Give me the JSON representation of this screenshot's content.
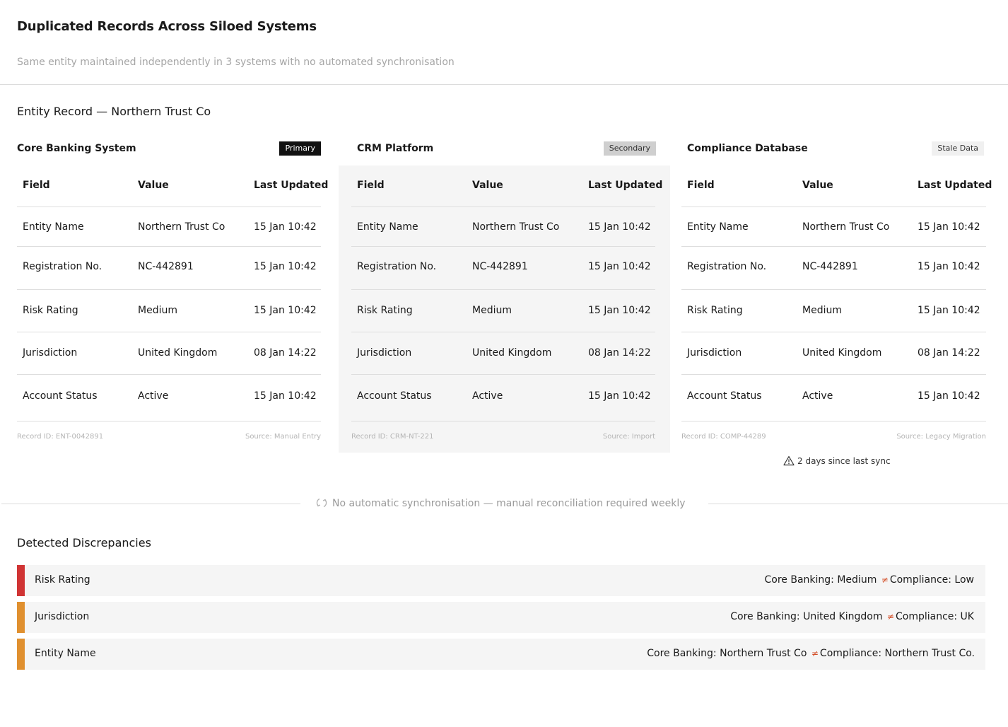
{
  "header": {
    "title": "Duplicated Records Across Siloed Systems",
    "subtitle": "Same entity maintained independently in 3 systems with no automated synchronisation"
  },
  "entity_heading": "Entity Record — Northern Trust Co",
  "columns": {
    "field": "Field",
    "value": "Value",
    "updated": "Last Updated"
  },
  "systems": [
    {
      "name": "Core Banking System",
      "badge": "Primary",
      "rows": [
        {
          "field": "Entity Name",
          "value": "Northern Trust Co",
          "updated": "15 Jan 10:42"
        },
        {
          "field": "Registration No.",
          "value": "NC-442891",
          "updated": "15 Jan 10:42"
        },
        {
          "field": "Risk Rating",
          "value": "Medium",
          "updated": "15 Jan 10:42"
        },
        {
          "field": "Jurisdiction",
          "value": "United Kingdom",
          "updated": "08 Jan 14:22"
        },
        {
          "field": "Account Status",
          "value": "Active",
          "updated": "15 Jan 10:42"
        }
      ],
      "record_id": "Record ID: ENT-0042891",
      "source": "Source: Manual Entry"
    },
    {
      "name": "CRM Platform",
      "badge": "Secondary",
      "rows": [
        {
          "field": "Entity Name",
          "value": "Northern Trust Co",
          "updated": "15 Jan 10:42"
        },
        {
          "field": "Registration No.",
          "value": "NC-442891",
          "updated": "15 Jan 10:42"
        },
        {
          "field": "Risk Rating",
          "value": "Medium",
          "updated": "15 Jan 10:42"
        },
        {
          "field": "Jurisdiction",
          "value": "United Kingdom",
          "updated": "08 Jan 14:22"
        },
        {
          "field": "Account Status",
          "value": "Active",
          "updated": "15 Jan 10:42"
        }
      ],
      "record_id": "Record ID: CRM-NT-221",
      "source": "Source: Import"
    },
    {
      "name": "Compliance Database",
      "badge": "Stale Data",
      "rows": [
        {
          "field": "Entity Name",
          "value": "Northern Trust Co",
          "updated": "15 Jan 10:42"
        },
        {
          "field": "Registration No.",
          "value": "NC-442891",
          "updated": "15 Jan 10:42"
        },
        {
          "field": "Risk Rating",
          "value": "Medium",
          "updated": "15 Jan 10:42"
        },
        {
          "field": "Jurisdiction",
          "value": "United Kingdom",
          "updated": "08 Jan 14:22"
        },
        {
          "field": "Account Status",
          "value": "Active",
          "updated": "15 Jan 10:42"
        }
      ],
      "record_id": "Record ID: COMP-44289",
      "source": "Source: Legacy Migration"
    }
  ],
  "sync_warning": "2 days since last sync",
  "sync_divider": "No automatic synchronisation — manual reconciliation required weekly",
  "discrepancies": {
    "heading": "Detected Discrepancies",
    "neq_symbol": "≠",
    "items": [
      {
        "label": "Risk Rating",
        "left": "Core Banking: Medium",
        "right": "Compliance: Low",
        "severity_color": "#d03434"
      },
      {
        "label": "Jurisdiction",
        "left": "Core Banking: United Kingdom",
        "right": "Compliance: UK",
        "severity_color": "#e0902f"
      },
      {
        "label": "Entity Name",
        "left": "Core Banking: Northern Trust Co",
        "right": "Compliance: Northern Trust Co.",
        "severity_color": "#e0902f"
      }
    ]
  },
  "icons": {
    "warning": "warning-triangle-icon",
    "sync": "sync-arrows-icon"
  }
}
